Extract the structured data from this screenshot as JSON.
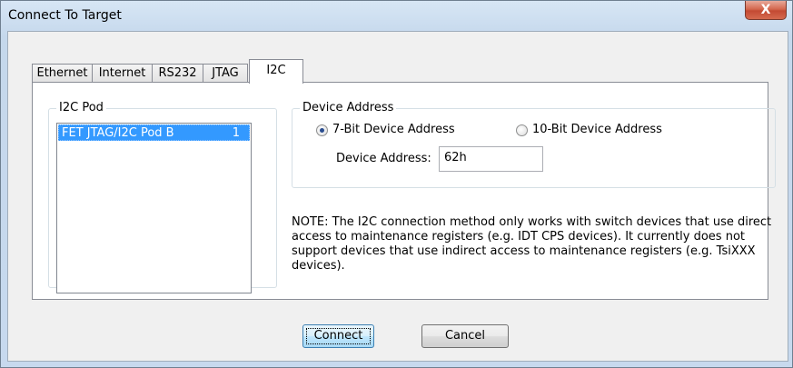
{
  "window": {
    "title": "Connect To Target",
    "close_glyph": "X"
  },
  "tabs": [
    {
      "label": "Ethernet",
      "active": false
    },
    {
      "label": "Internet",
      "active": false
    },
    {
      "label": "RS232",
      "active": false
    },
    {
      "label": "JTAG",
      "active": false
    },
    {
      "label": "I2C",
      "active": true
    }
  ],
  "pod_group": {
    "title": "I2C Pod",
    "items": [
      {
        "name": "FET JTAG/I2C Pod B",
        "number": "1",
        "selected": true
      }
    ]
  },
  "address_group": {
    "title": "Device Address",
    "options": [
      {
        "label": "7-Bit Device Address",
        "checked": true
      },
      {
        "label": "10-Bit Device Address",
        "checked": false
      }
    ],
    "field_label": "Device Address:",
    "field_value": "62h"
  },
  "note": "NOTE: The I2C connection method only works with switch devices that use direct access to maintenance registers (e.g. IDT CPS devices).  It currently does not support devices that use indirect access to maintenance registers (e.g. TsiXXX devices).",
  "buttons": {
    "connect": "Connect",
    "cancel": "Cancel"
  },
  "colors": {
    "selection": "#3399ff",
    "title_bar": "#c5d8ec",
    "close_button": "#c34a33"
  },
  "icons": {
    "close": "close-icon",
    "radio": "radio-button"
  }
}
